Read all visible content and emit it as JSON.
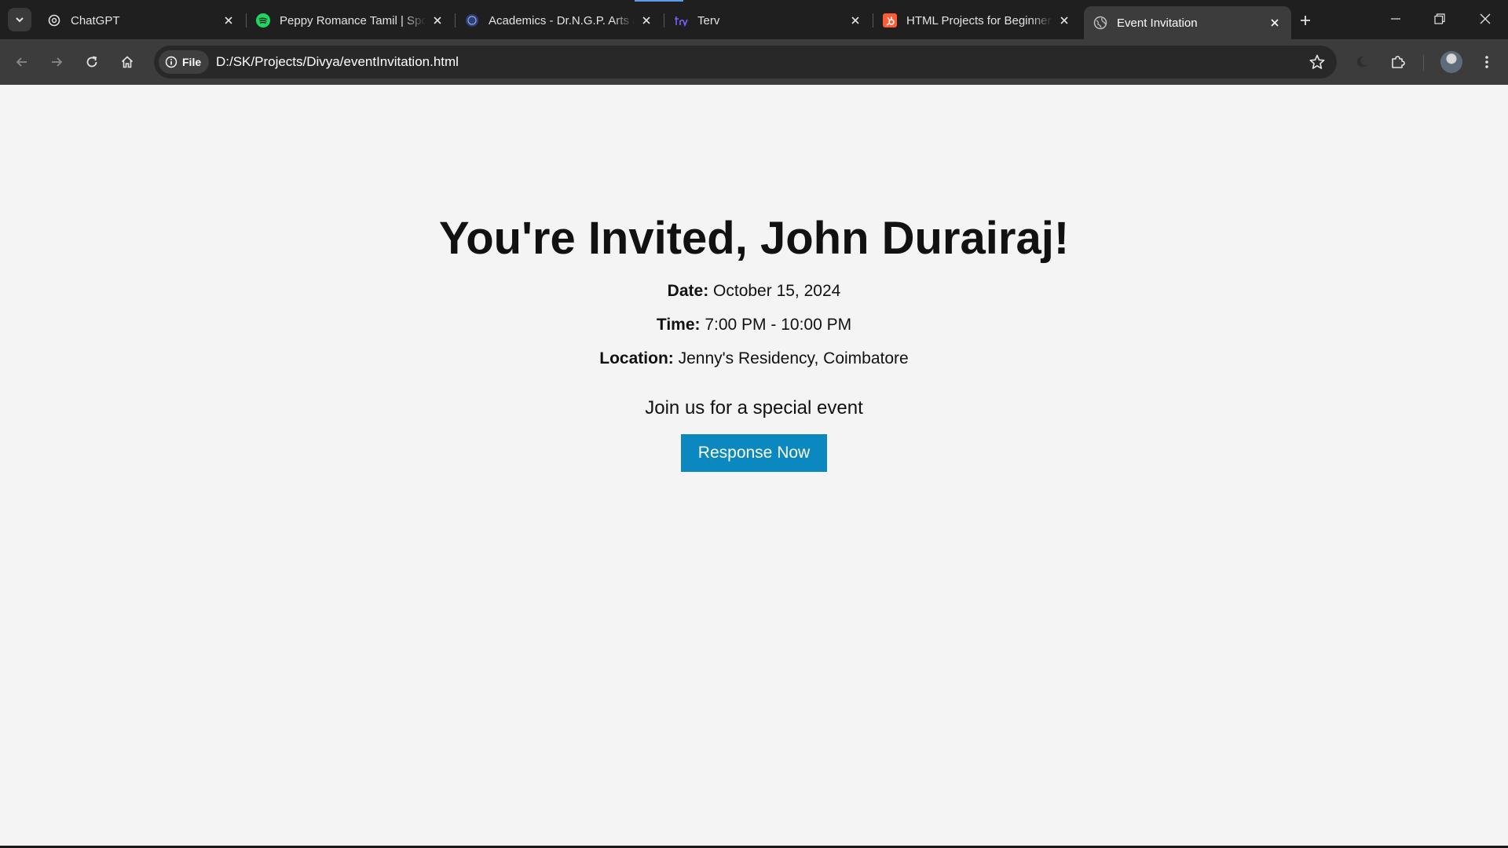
{
  "browser": {
    "tabs": [
      {
        "title": "ChatGPT",
        "icon": "chatgpt-icon",
        "active": false
      },
      {
        "title": "Peppy Romance Tamil | Spotify",
        "icon": "spotify-icon",
        "active": false
      },
      {
        "title": "Academics - Dr.N.G.P. Arts and Science College",
        "icon": "college-icon",
        "active": false
      },
      {
        "title": "Terv",
        "icon": "terv-icon",
        "active": false
      },
      {
        "title": "HTML Projects for Beginners",
        "icon": "hubspot-icon",
        "active": false
      },
      {
        "title": "Event Invitation",
        "icon": "globe-icon",
        "active": true
      }
    ],
    "address": {
      "chip_label": "File",
      "url": "D:/SK/Projects/Divya/eventInvitation.html"
    },
    "colors": {
      "tab_strip": "#1f1f1f",
      "toolbar": "#3c3c3c",
      "omnibox": "#282828",
      "spotify": "#1ed760",
      "hubspot": "#ff5c35"
    }
  },
  "page": {
    "heading": "You're Invited, John Durairaj!",
    "details": [
      {
        "label": "Date:",
        "value": "October 15, 2024"
      },
      {
        "label": "Time:",
        "value": "7:00 PM - 10:00 PM"
      },
      {
        "label": "Location:",
        "value": "Jenny's Residency, Coimbatore"
      }
    ],
    "tagline": "Join us for a special event",
    "button_label": "Response Now",
    "colors": {
      "background": "#f4f4f4",
      "button": "#0a88bf",
      "button_text": "#ffffff"
    }
  }
}
